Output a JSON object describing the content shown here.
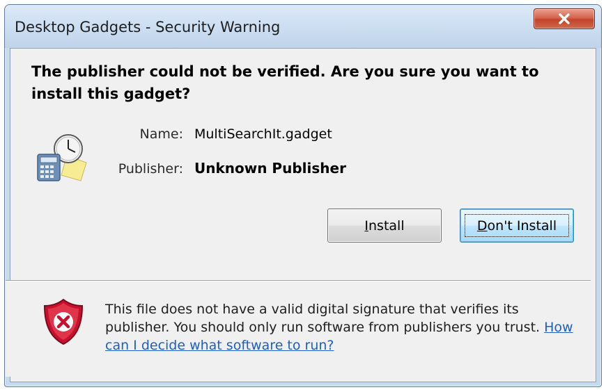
{
  "window": {
    "title": "Desktop Gadgets - Security Warning",
    "close_glyph": "X"
  },
  "dialog": {
    "headline": "The publisher could not be verified. Are you sure you want to install this gadget?",
    "icon": "gadget-calculator-clock-icon",
    "name_label": "Name:",
    "name_value": "MultiSearchIt.gadget",
    "publisher_label": "Publisher:",
    "publisher_value": "Unknown Publisher"
  },
  "buttons": {
    "install": {
      "mnemonic": "I",
      "rest": "nstall"
    },
    "dont_install": {
      "mnemonic": "D",
      "rest": "on't Install"
    }
  },
  "footer": {
    "icon": "security-shield-x-icon",
    "warning_text": "This file does not have a valid digital signature that verifies its publisher. You should only run software from publishers you trust. ",
    "help_link": "How can I decide what software to run?"
  },
  "colors": {
    "link": "#1d5fc4",
    "close_button": "#c2432a",
    "default_button_border": "#3c7fb1",
    "shield_red": "#c8102e"
  }
}
